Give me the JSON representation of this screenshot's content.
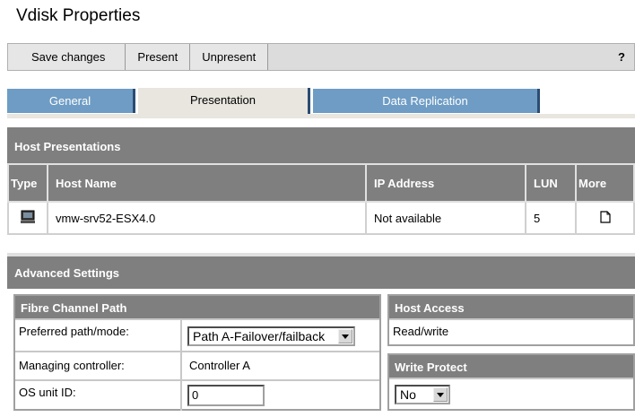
{
  "page": {
    "title": "Vdisk Properties"
  },
  "toolbar": {
    "save": "Save changes",
    "present": "Present",
    "unpresent": "Unpresent",
    "help": "?"
  },
  "tabs": [
    {
      "label": "General",
      "active": false
    },
    {
      "label": "Presentation",
      "active": true
    },
    {
      "label": "Data Replication",
      "active": false
    }
  ],
  "host_presentations": {
    "title": "Host Presentations",
    "columns": [
      "Type",
      "Host Name",
      "IP Address",
      "LUN",
      "More"
    ],
    "rows": [
      {
        "type_icon": "server-icon",
        "host_name": "vmw-srv52-ESX4.0",
        "ip_address": "Not available",
        "lun": "5",
        "more_icon": "document-icon"
      }
    ]
  },
  "advanced": {
    "title": "Advanced Settings",
    "fibre_channel": {
      "title": "Fibre Channel Path",
      "preferred_label": "Preferred path/mode:",
      "preferred_value": "Path A-Failover/failback",
      "managing_label": "Managing controller:",
      "managing_value": "Controller A",
      "os_unit_label": "OS unit ID:",
      "os_unit_value": "0"
    },
    "host_access": {
      "title": "Host Access",
      "value": "Read/write"
    },
    "write_protect": {
      "title": "Write Protect",
      "value": "No"
    }
  },
  "colors": {
    "tab_inactive": "#6e9cc4",
    "header_gray": "#7f7f7f",
    "tab_active": "#e8e6df"
  }
}
